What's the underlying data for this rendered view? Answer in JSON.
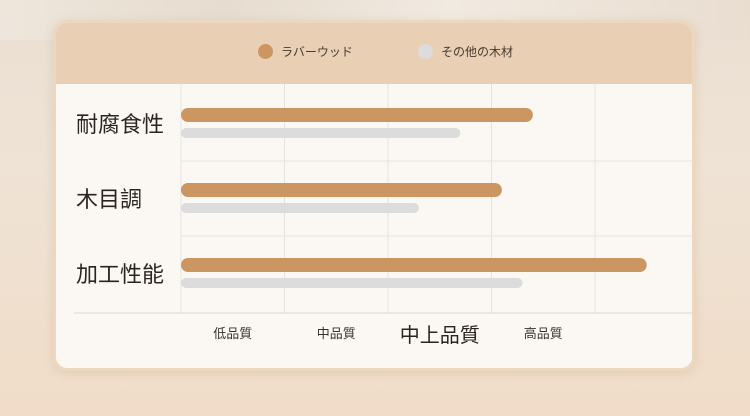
{
  "chart_data": {
    "type": "bar",
    "orientation": "horizontal",
    "categories": [
      "耐腐食性",
      "木目調",
      "加工性能"
    ],
    "x_ticks": [
      "低品質",
      "中品質",
      "中上品質",
      "高品質"
    ],
    "highlighted_tick": "中上品質",
    "series": [
      {
        "name": "ラバーウッド",
        "values": [
          3.4,
          3.1,
          4.5
        ],
        "color": "#cc9662"
      },
      {
        "name": "その他の木材",
        "values": [
          2.7,
          2.3,
          3.3
        ],
        "color": "#dcdcdc"
      }
    ],
    "xlim": [
      0,
      5
    ],
    "grid": true,
    "legend": "top-center"
  }
}
